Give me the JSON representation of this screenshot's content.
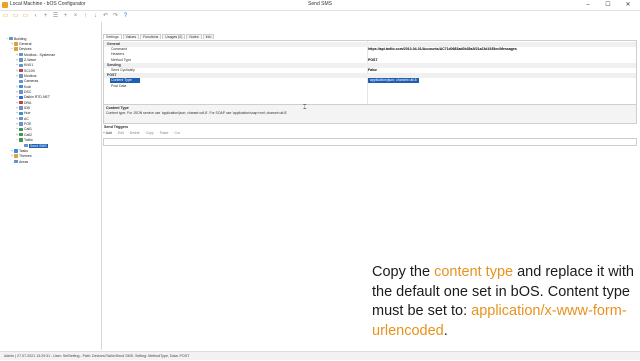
{
  "window": {
    "app_title": "Local Machine - bOS Configurator",
    "title": "Send SMS",
    "controls": [
      "–",
      "☐",
      "✕"
    ]
  },
  "toolbar": {
    "buttons": [
      {
        "icon": "new-icon",
        "glyph": "▭"
      },
      {
        "icon": "open-icon",
        "glyph": "▭"
      },
      {
        "icon": "save-icon",
        "glyph": "▭"
      },
      {
        "icon": "back-icon",
        "glyph": "‹"
      },
      {
        "icon": "add-icon",
        "glyph": "+"
      },
      {
        "icon": "list-icon",
        "glyph": "☰"
      },
      {
        "icon": "add-item-icon",
        "glyph": "+"
      },
      {
        "icon": "delete-icon",
        "glyph": "×"
      },
      {
        "icon": "up-arrow-icon",
        "glyph": "↑"
      },
      {
        "icon": "down-arrow-icon",
        "glyph": "↓"
      },
      {
        "icon": "undo-icon",
        "glyph": "↶"
      },
      {
        "icon": "redo-icon",
        "glyph": "↷"
      },
      {
        "icon": "help-icon",
        "glyph": "?"
      }
    ]
  },
  "tree": [
    {
      "label": "Building",
      "depth": 0,
      "expander": "−",
      "color": "#6b8fc7"
    },
    {
      "label": "General",
      "depth": 1,
      "expander": "+",
      "color": "#e0a040"
    },
    {
      "label": "Devices",
      "depth": 1,
      "expander": "−",
      "color": "#e0a040"
    },
    {
      "label": "Modbus - Systemair",
      "depth": 2,
      "expander": "+",
      "color": "#6b8fc7"
    },
    {
      "label": "Z-Wave",
      "depth": 2,
      "expander": "+",
      "color": "#6b8fc7"
    },
    {
      "label": "KNX1",
      "depth": 2,
      "expander": "+",
      "color": "#6b8fc7"
    },
    {
      "label": "SC100",
      "depth": 2,
      "expander": "+",
      "color": "#c04040"
    },
    {
      "label": "Modbus",
      "depth": 2,
      "expander": "+",
      "color": "#6b8fc7"
    },
    {
      "label": "Cameras",
      "depth": 2,
      "expander": "",
      "color": "#6b8fc7"
    },
    {
      "label": "Kodi",
      "depth": 2,
      "expander": "+",
      "color": "#3a8fd0"
    },
    {
      "label": "DSC",
      "depth": 2,
      "expander": "+",
      "color": "#6b8fc7"
    },
    {
      "label": "Daikin RTD-NET",
      "depth": 2,
      "expander": "+",
      "color": "#2a6fc9"
    },
    {
      "label": "DRA",
      "depth": 2,
      "expander": "+",
      "color": "#c04040"
    },
    {
      "label": "IDB",
      "depth": 2,
      "expander": "+",
      "color": "#6b8fc7"
    },
    {
      "label": "Hue",
      "depth": 2,
      "expander": "+",
      "color": "#3a8fd0"
    },
    {
      "label": "AC",
      "depth": 2,
      "expander": "+",
      "color": "#6b8fc7"
    },
    {
      "label": "POE",
      "depth": 2,
      "expander": "+",
      "color": "#6b8fc7"
    },
    {
      "label": "Call1",
      "depth": 2,
      "expander": "+",
      "color": "#3a9a50"
    },
    {
      "label": "Call2",
      "depth": 2,
      "expander": "+",
      "color": "#3a9a50"
    },
    {
      "label": "Twilio",
      "depth": 2,
      "expander": "−",
      "color": "#3a9a50"
    },
    {
      "label": "Send SMS",
      "depth": 3,
      "expander": "",
      "color": "#6b8fc7",
      "selected": true
    },
    {
      "label": "Tasks",
      "depth": 1,
      "expander": "+",
      "color": "#3a8fd0"
    },
    {
      "label": "Themes",
      "depth": 1,
      "expander": "+",
      "color": "#e0a040"
    },
    {
      "label": "Areas",
      "depth": 1,
      "expander": "",
      "color": "#6b8fc7"
    }
  ],
  "tabs": [
    "Settings",
    "Values",
    "Functions",
    "Usages (0)",
    "Notes",
    "Info"
  ],
  "grid": [
    {
      "kind": "category",
      "name": "General"
    },
    {
      "kind": "row",
      "name": "Command",
      "value": "https://api.twilio.com/2010-04-01/Accounts/AC71d0683ad0b35a3f21a23d1935ec/Messages"
    },
    {
      "kind": "row",
      "name": "Headers",
      "value": ""
    },
    {
      "kind": "row",
      "name": "Method Type",
      "value": "POST"
    },
    {
      "kind": "category",
      "name": "Sending"
    },
    {
      "kind": "row",
      "name": "Send Cyclically",
      "value": "False"
    },
    {
      "kind": "category",
      "name": "POST"
    },
    {
      "kind": "row",
      "name": "Content Type",
      "value": "application/json; charset=utf-8",
      "highlighted": true
    },
    {
      "kind": "row",
      "name": "Post Data",
      "value": ""
    }
  ],
  "description": {
    "title": "Content Type",
    "text": "Content type. For JSON service use 'application/json; charset=utf-8'. For SOAP use 'application/soap+xml; charset=utf-8'"
  },
  "triggers": {
    "title": "Send Triggers",
    "buttons": [
      {
        "label": "Add",
        "enabled": true,
        "icon": "add-icon"
      },
      {
        "label": "Edit",
        "enabled": false,
        "icon": "edit-icon"
      },
      {
        "label": "Delete",
        "enabled": false,
        "icon": "delete-icon"
      },
      {
        "label": "Copy",
        "enabled": false,
        "icon": "copy-icon"
      },
      {
        "label": "Paste",
        "enabled": false,
        "icon": "paste-icon"
      },
      {
        "label": "Cut",
        "enabled": false,
        "icon": "cut-icon"
      }
    ]
  },
  "caption": {
    "p1": "Copy the ",
    "p2": "content type",
    "p3": " and replace it with the default one set in bOS. Content type must be set to: ",
    "p4": "application/x-www-form-urlencoded",
    "p5": "."
  },
  "status": "Admin | 27.07.2021 13:29:31 - User: SetSetting - Path: Devices\\Twilio\\Send SMS, Setting: MethodType, Data: POST",
  "colors": {
    "accent": "#e8921e",
    "selection": "#1e5fb4"
  }
}
